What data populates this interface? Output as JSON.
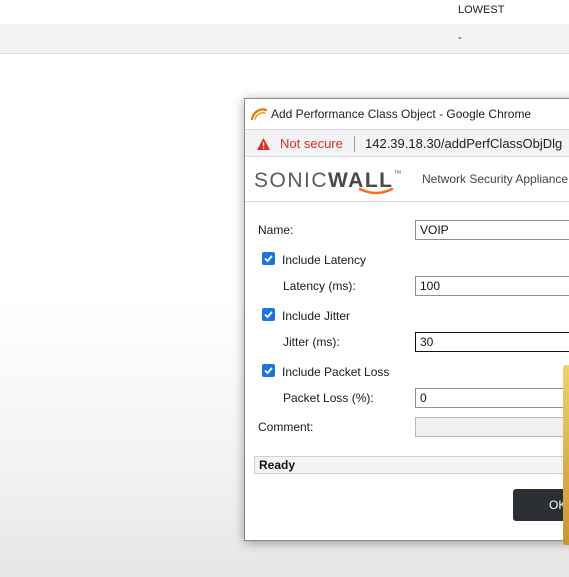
{
  "background": {
    "row1_value": "LOWEST",
    "row2_value": "-"
  },
  "popup": {
    "window_title": "Add Performance Class Object - Google Chrome",
    "security_label": "Not secure",
    "url": "142.39.18.30/addPerfClassObjDlg",
    "brand_name_light": "SONIC",
    "brand_name_bold": "WALL",
    "brand_tm": "™",
    "brand_subtitle": "Network Security Appliance",
    "form": {
      "name_label": "Name:",
      "name_value": "VOIP",
      "include_latency_label": "Include Latency",
      "include_latency_checked": true,
      "latency_label": "Latency (ms):",
      "latency_value": "100",
      "include_jitter_label": "Include Jitter",
      "include_jitter_checked": true,
      "jitter_label": "Jitter (ms):",
      "jitter_value": "30",
      "include_packet_loss_label": "Include Packet Loss",
      "include_packet_loss_checked": true,
      "packet_loss_label": "Packet Loss (%):",
      "packet_loss_value": "0",
      "comment_label": "Comment:",
      "comment_value": ""
    },
    "status_text": "Ready",
    "ok_label": "OK",
    "colors": {
      "accent": "#1a73e8",
      "warning": "#d93025",
      "ok_button": "#2b2f34"
    }
  }
}
